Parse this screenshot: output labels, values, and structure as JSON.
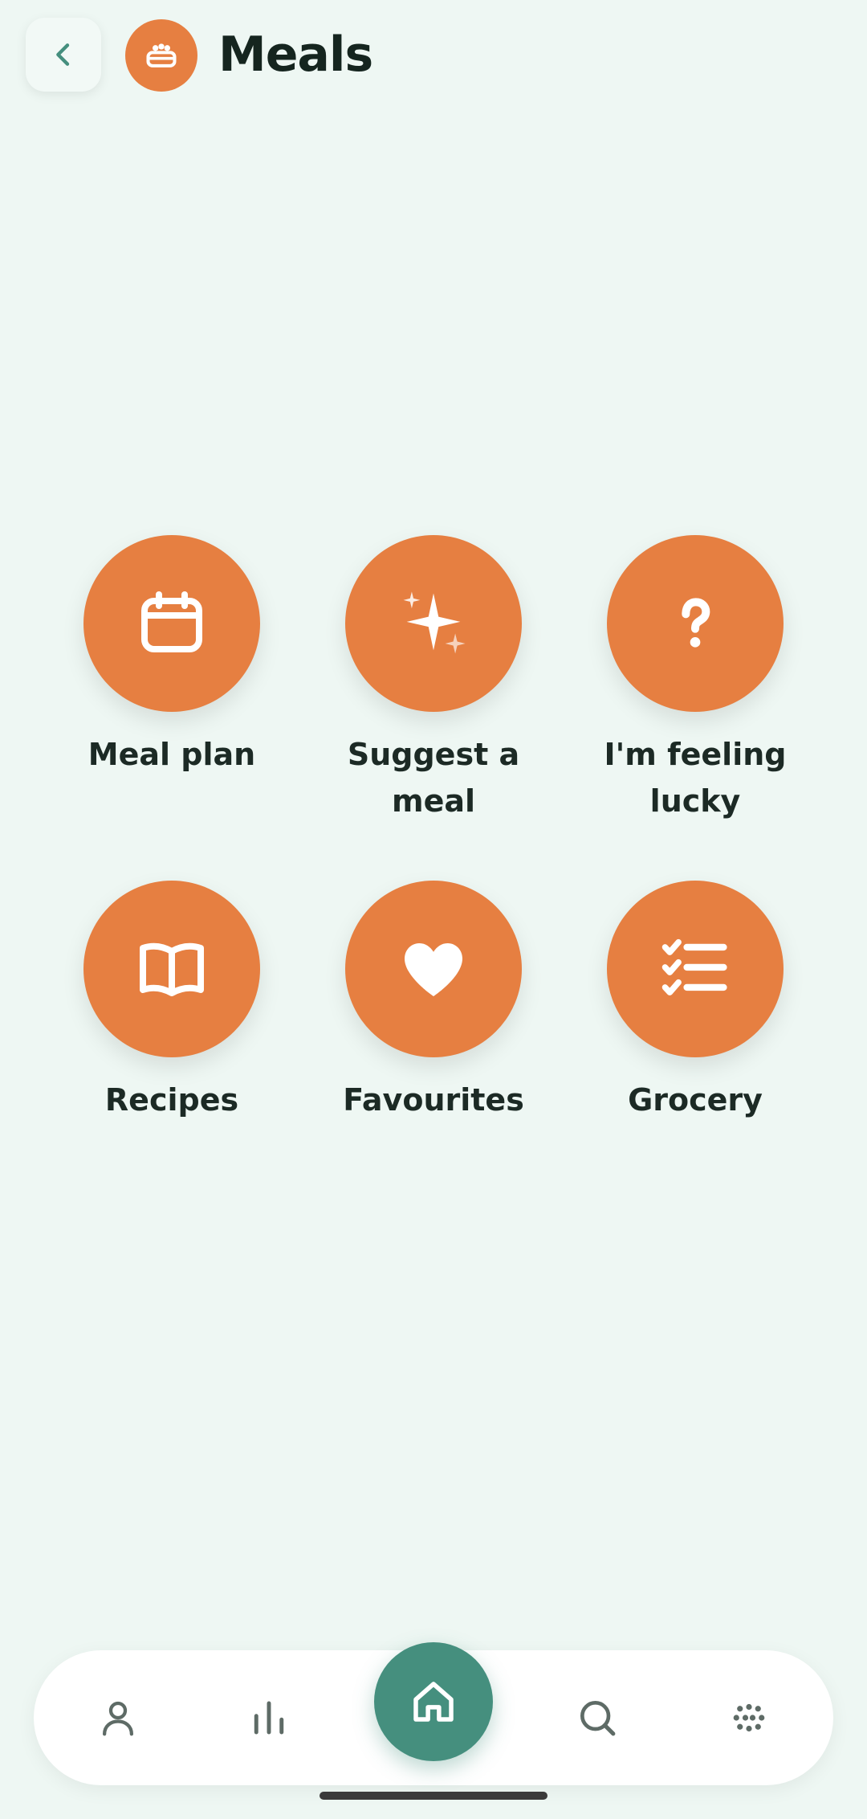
{
  "header": {
    "title": "Meals",
    "back_icon": "chevron-left-icon",
    "section_icon": "bread-basket-icon"
  },
  "colors": {
    "background": "#EEF7F3",
    "accent": "#E67F41",
    "primary": "#458F7E",
    "text": "#15251F"
  },
  "actions": [
    {
      "label": "Meal plan",
      "icon": "calendar-icon"
    },
    {
      "label": "Suggest a meal",
      "icon": "sparkles-icon"
    },
    {
      "label": "I'm feeling lucky",
      "icon": "question-mark-icon"
    },
    {
      "label": "Recipes",
      "icon": "open-book-icon"
    },
    {
      "label": "Favourites",
      "icon": "heart-icon"
    },
    {
      "label": "Grocery",
      "icon": "checklist-icon"
    }
  ],
  "bottom_nav": {
    "items": [
      {
        "icon": "person-icon"
      },
      {
        "icon": "bar-chart-icon"
      },
      {
        "icon": "home-icon",
        "active": true
      },
      {
        "icon": "search-icon"
      },
      {
        "icon": "dots-grid-icon"
      }
    ]
  }
}
